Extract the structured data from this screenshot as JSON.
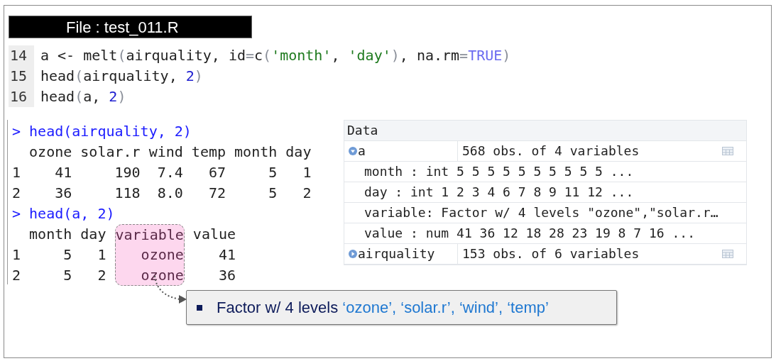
{
  "file_title": "File : test_011.R",
  "editor": {
    "lines": [
      {
        "number": "14",
        "tokens": [
          {
            "text": "a <- melt",
            "kind": "plain"
          },
          {
            "text": "(",
            "kind": "paren"
          },
          {
            "text": "airquality, id",
            "kind": "plain"
          },
          {
            "text": "=",
            "kind": "paren"
          },
          {
            "text": "c",
            "kind": "plain"
          },
          {
            "text": "(",
            "kind": "paren"
          },
          {
            "text": "'month'",
            "kind": "string"
          },
          {
            "text": ", ",
            "kind": "plain"
          },
          {
            "text": "'day'",
            "kind": "string"
          },
          {
            "text": ")",
            "kind": "paren"
          },
          {
            "text": ", na.rm",
            "kind": "plain"
          },
          {
            "text": "=",
            "kind": "paren"
          },
          {
            "text": "TRUE",
            "kind": "constant"
          },
          {
            "text": ")",
            "kind": "paren"
          }
        ]
      },
      {
        "number": "15",
        "tokens": [
          {
            "text": "head",
            "kind": "plain"
          },
          {
            "text": "(",
            "kind": "paren"
          },
          {
            "text": "airquality, ",
            "kind": "plain"
          },
          {
            "text": "2",
            "kind": "number"
          },
          {
            "text": ")",
            "kind": "paren"
          }
        ]
      },
      {
        "number": "16",
        "tokens": [
          {
            "text": "head",
            "kind": "plain"
          },
          {
            "text": "(",
            "kind": "paren"
          },
          {
            "text": "a, ",
            "kind": "plain"
          },
          {
            "text": "2",
            "kind": "number"
          },
          {
            "text": ")",
            "kind": "paren"
          }
        ]
      }
    ]
  },
  "console": {
    "lines": [
      {
        "kind": "command",
        "segments": [
          {
            "text": "> head(airquality, 2)",
            "highlighted": false
          }
        ]
      },
      {
        "kind": "output",
        "segments": [
          {
            "text": "  ozone solar.r wind temp month day",
            "highlighted": false
          }
        ]
      },
      {
        "kind": "output",
        "segments": [
          {
            "text": "1    41     190  7.4   67     5   1",
            "highlighted": false
          }
        ]
      },
      {
        "kind": "output",
        "segments": [
          {
            "text": "2    36     118  8.0   72     5   2",
            "highlighted": false
          }
        ]
      },
      {
        "kind": "command",
        "segments": [
          {
            "text": "> head(a, 2)",
            "highlighted": false
          }
        ]
      },
      {
        "kind": "output",
        "segments": [
          {
            "text": "  month day ",
            "highlighted": false
          },
          {
            "text": "variable",
            "highlighted": true
          },
          {
            "text": " value",
            "highlighted": false
          }
        ]
      },
      {
        "kind": "output",
        "segments": [
          {
            "text": "1     5   1 ",
            "highlighted": false
          },
          {
            "text": "   ozone",
            "highlighted": true
          },
          {
            "text": "    41",
            "highlighted": false
          }
        ]
      },
      {
        "kind": "output",
        "segments": [
          {
            "text": "2     5   2 ",
            "highlighted": false
          },
          {
            "text": "   ozone",
            "highlighted": true
          },
          {
            "text": "    36",
            "highlighted": false
          }
        ]
      }
    ]
  },
  "environment": {
    "section": "Data",
    "objects": [
      {
        "name": "a",
        "summary": "568 obs. of 4 variables",
        "expanded": true,
        "children": [
          "month : int 5 5 5 5 5 5 5 5 5 5 ...",
          "day : int 1 2 3 4 6 7 8 9 11 12 ...",
          "variable: Factor w/ 4 levels \"ozone\",\"solar.r…",
          "value : num 41 36 12 18 28 23 19 8 7 16 ..."
        ]
      },
      {
        "name": "airquality",
        "summary": "153 obs. of 6 variables",
        "expanded": false
      }
    ]
  },
  "callout": {
    "lead": "Factor w/ 4 levels",
    "levels": "‘ozone’, ‘solar.r’, ‘wind’, ‘temp’"
  }
}
